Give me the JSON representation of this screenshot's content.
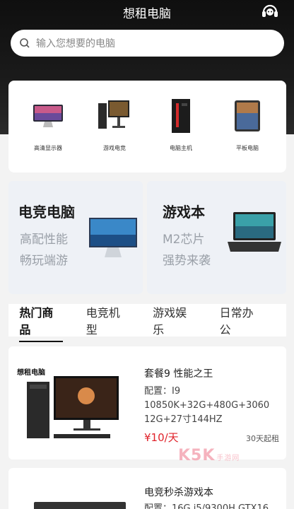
{
  "header": {
    "title": "想租电脑",
    "service_icon": "headset-icon"
  },
  "search": {
    "placeholder": "输入您想要的电脑",
    "icon": "search-icon"
  },
  "categories": [
    {
      "label": "高清显示器",
      "icon": "monitor"
    },
    {
      "label": "游戏电竞",
      "icon": "gaming-pc"
    },
    {
      "label": "电脑主机",
      "icon": "pc-tower"
    },
    {
      "label": "平板电脑",
      "icon": "tablet"
    }
  ],
  "promos": [
    {
      "title": "电竞电脑",
      "line1": "高配性能",
      "line2": "畅玩端游"
    },
    {
      "title": "游戏本",
      "line1": "M2芯片",
      "line2": "强势来袭"
    }
  ],
  "tabs": [
    "热门商品",
    "电竞机型",
    "游戏娱乐",
    "日常办公"
  ],
  "products": [
    {
      "brand": "想租电脑",
      "name": "套餐9 性能之王",
      "config": "配置：I9 10850K+32G+480G+3060 12G+27寸144HZ",
      "price": "¥10/天",
      "min": "30天起租"
    },
    {
      "name": "电竞秒杀游戏本",
      "config": "配置：16G i5/9300H GTX16"
    }
  ],
  "watermark": {
    "main": "K5K",
    "sub": "手游网"
  },
  "colors": {
    "price": "#e0222a",
    "header_bg": "#111111"
  }
}
